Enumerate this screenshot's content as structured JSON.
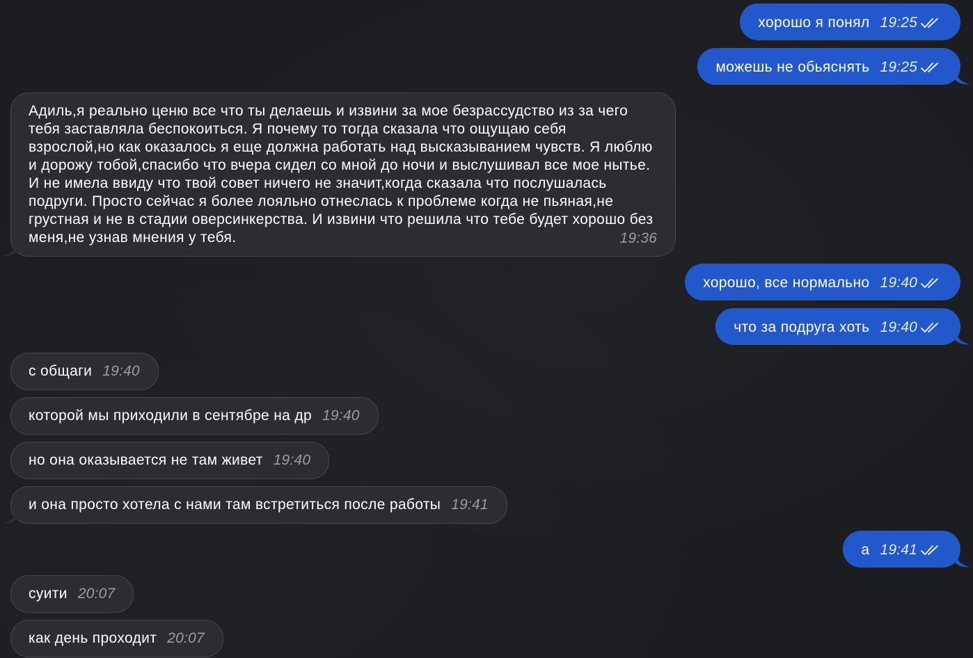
{
  "colors": {
    "background": "#1b1d21",
    "incoming_bubble": "#2c2d30",
    "outgoing_bubble": "#2258cc"
  },
  "messages": [
    {
      "direction": "out",
      "text": "хорошо я понял",
      "time": "19:25",
      "status_icon": "double-check-icon"
    },
    {
      "direction": "out",
      "text": "можешь не обьяснять",
      "time": "19:25",
      "status_icon": "double-check-icon"
    },
    {
      "direction": "in",
      "text": "Адиль,я реально ценю все что ты делаешь и извини за мое безрассудство из за чего тебя заставляла беспокоиться. Я почему то тогда сказала что ощущаю себя взрослой,но как оказалось я еще должна работать над высказыванием чувств. Я люблю и дорожу тобой,спасибо что вчера сидел со мной до ночи и выслушивал все мое нытье. И не имела ввиду что твой совет ничего не значит,когда сказала что послушалась подруги. Просто сейчас я более лояльно отнеслась к проблеме когда не пьяная,не грустная и не в стадии оверсинкерства. И извини что решила что тебе будет хорошо без меня,не узнав мнения у тебя.",
      "time": "19:36"
    },
    {
      "direction": "out",
      "text": "хорошо, все нормально",
      "time": "19:40",
      "status_icon": "double-check-icon"
    },
    {
      "direction": "out",
      "text": "что за подруга хоть",
      "time": "19:40",
      "status_icon": "double-check-icon"
    },
    {
      "direction": "in",
      "text": "с общаги",
      "time": "19:40"
    },
    {
      "direction": "in",
      "text": "которой мы приходили в сентябре на др",
      "time": "19:40"
    },
    {
      "direction": "in",
      "text": "но она оказывается не там живет",
      "time": "19:40"
    },
    {
      "direction": "in",
      "text": "и она просто хотела с нами там встретиться после работы",
      "time": "19:41"
    },
    {
      "direction": "out",
      "text": "а",
      "time": "19:41",
      "status_icon": "double-check-icon"
    },
    {
      "direction": "in",
      "text": "суити",
      "time": "20:07"
    },
    {
      "direction": "in",
      "text": "как день проходит",
      "time": "20:07"
    }
  ]
}
